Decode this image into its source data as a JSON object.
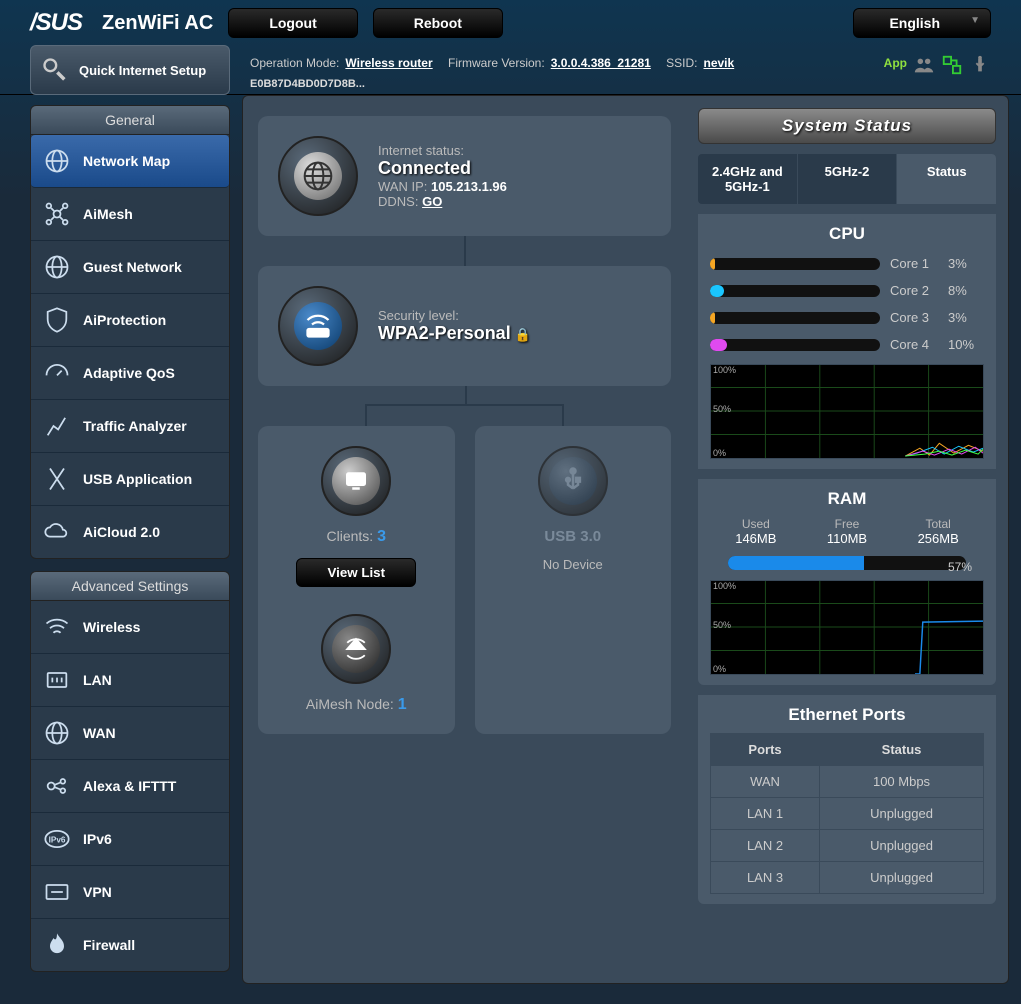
{
  "product": "ZenWiFi AC",
  "top": {
    "logout": "Logout",
    "reboot": "Reboot",
    "lang": "English"
  },
  "info": {
    "opmode_label": "Operation Mode:",
    "opmode": "Wireless router",
    "fw_label": "Firmware Version:",
    "fw": "3.0.0.4.386_21281",
    "ssid_label": "SSID:",
    "ssid": "nevik",
    "mac": "E0B87D4BD0D7D8B...",
    "app": "App"
  },
  "qis": "Quick Internet Setup",
  "general_hdr": "General",
  "general": [
    "Network Map",
    "AiMesh",
    "Guest Network",
    "AiProtection",
    "Adaptive QoS",
    "Traffic Analyzer",
    "USB Application",
    "AiCloud 2.0"
  ],
  "advanced_hdr": "Advanced Settings",
  "advanced": [
    "Wireless",
    "LAN",
    "WAN",
    "Alexa & IFTTT",
    "IPv6",
    "VPN",
    "Firewall"
  ],
  "internet": {
    "status_label": "Internet status:",
    "status": "Connected",
    "wanip_label": "WAN IP:",
    "wanip": "105.213.1.96",
    "ddns_label": "DDNS:",
    "ddns": "GO"
  },
  "security": {
    "label": "Security level:",
    "level": "WPA2-Personal"
  },
  "clients": {
    "label": "Clients:",
    "count": "3",
    "view_list": "View List"
  },
  "aimesh_node": {
    "label": "AiMesh Node:",
    "count": "1"
  },
  "usb": {
    "title": "USB 3.0",
    "status": "No Device"
  },
  "status_hdr": "System Status",
  "tabs": [
    "2.4GHz and 5GHz-1",
    "5GHz-2",
    "Status"
  ],
  "cpu": {
    "title": "CPU",
    "cores": [
      {
        "name": "Core 1",
        "pct": 3,
        "color": "#f5a623"
      },
      {
        "name": "Core 2",
        "pct": 8,
        "color": "#1ac6ff"
      },
      {
        "name": "Core 3",
        "pct": 3,
        "color": "#f5a623"
      },
      {
        "name": "Core 4",
        "pct": 10,
        "color": "#e04af0"
      }
    ]
  },
  "ram": {
    "title": "RAM",
    "used_label": "Used",
    "used": "146MB",
    "free_label": "Free",
    "free": "110MB",
    "total_label": "Total",
    "total": "256MB",
    "pct": 57
  },
  "eth": {
    "title": "Ethernet Ports",
    "ports_hdr": "Ports",
    "status_hdr": "Status",
    "rows": [
      {
        "port": "WAN",
        "status": "100 Mbps"
      },
      {
        "port": "LAN 1",
        "status": "Unplugged"
      },
      {
        "port": "LAN 2",
        "status": "Unplugged"
      },
      {
        "port": "LAN 3",
        "status": "Unplugged"
      }
    ]
  }
}
